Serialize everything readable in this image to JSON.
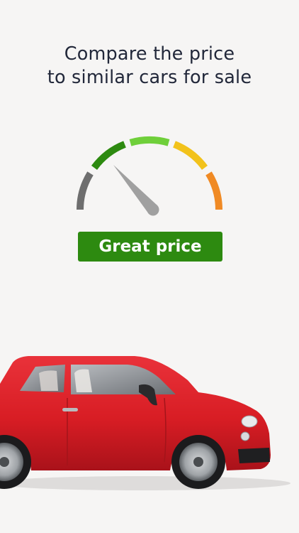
{
  "headline": {
    "line1": "Compare the price",
    "line2": "to similar cars for sale"
  },
  "gauge": {
    "segments": [
      {
        "name": "poor",
        "color": "#6e6e6e"
      },
      {
        "name": "great",
        "color": "#2d8a10"
      },
      {
        "name": "good",
        "color": "#6fcf3a"
      },
      {
        "name": "fair",
        "color": "#f2c21b"
      },
      {
        "name": "high",
        "color": "#f08a24"
      }
    ],
    "needle_color": "#a0a0a0"
  },
  "badge": {
    "label": "Great price",
    "color": "#2d8a10"
  },
  "car": {
    "body_color": "#d81d24"
  },
  "colors": {
    "background": "#f6f5f4",
    "text": "#22283a"
  }
}
